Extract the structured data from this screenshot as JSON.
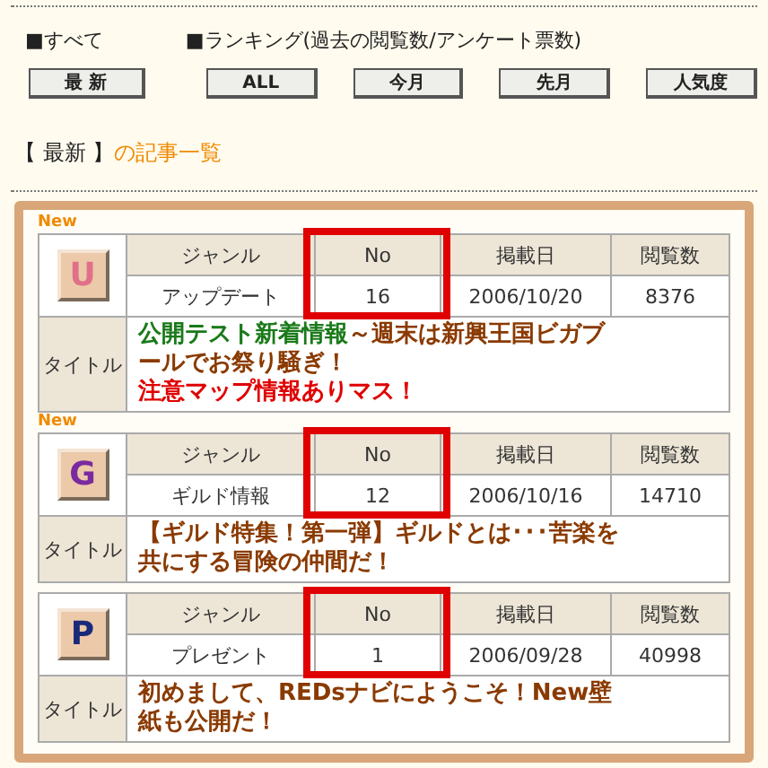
{
  "filters": {
    "all_label": "■すべて",
    "ranking_label": "■ランキング(過去の閲覧数/アンケート票数)",
    "buttons": [
      "最 新",
      "ALL",
      "今月",
      "先月",
      "人気度"
    ]
  },
  "heading": {
    "current": "【 最新 】",
    "suffix": "の記事一覧"
  },
  "articles": [
    {
      "new_badge": "New",
      "icon_letter": "U",
      "color": "#e0708a",
      "genre_header": "ジャンル",
      "no_header": "No",
      "date_header": "掲載日",
      "views_header": "閲覧数",
      "genre": "アップデート",
      "no": "16",
      "date": "2006/10/20",
      "views": "8376",
      "no_highlighted": true,
      "title_label": "タイトル",
      "title_lines": [
        [
          {
            "text": "公開テスト新着情報",
            "color": "#1a7a1a"
          },
          {
            "text": "～週末は新興王国ビガブールでお祭り騒ぎ！",
            "color": "#8a3a00"
          }
        ],
        [
          {
            "text": "注意マップ情報ありマス！",
            "color": "#e00000"
          }
        ]
      ]
    },
    {
      "new_badge": "New",
      "icon_letter": "G",
      "color": "#7a2aa0",
      "genre_header": "ジャンル",
      "no_header": "No",
      "date_header": "掲載日",
      "views_header": "閲覧数",
      "genre": "ギルド情報",
      "no": "12",
      "date": "2006/10/16",
      "views": "14710",
      "no_highlighted": true,
      "title_label": "タイトル",
      "title_lines": [
        [
          {
            "text": "【ギルド特集！第一弾】ギルドとは･･･苦楽を共にする冒険の仲間だ！",
            "color": "#8a3a00"
          }
        ]
      ]
    },
    {
      "icon_letter": "P",
      "color": "#1a2a7a",
      "genre_header": "ジャンル",
      "no_header": "No",
      "date_header": "掲載日",
      "views_header": "閲覧数",
      "genre": "プレゼント",
      "no": "1",
      "date": "2006/09/28",
      "views": "40998",
      "no_highlighted": true,
      "title_label": "タイトル",
      "title_lines": [
        [
          {
            "text": "初めまして、REDsナビにようこそ！New壁紙も公開だ！",
            "color": "#8a3a00"
          }
        ]
      ]
    }
  ]
}
